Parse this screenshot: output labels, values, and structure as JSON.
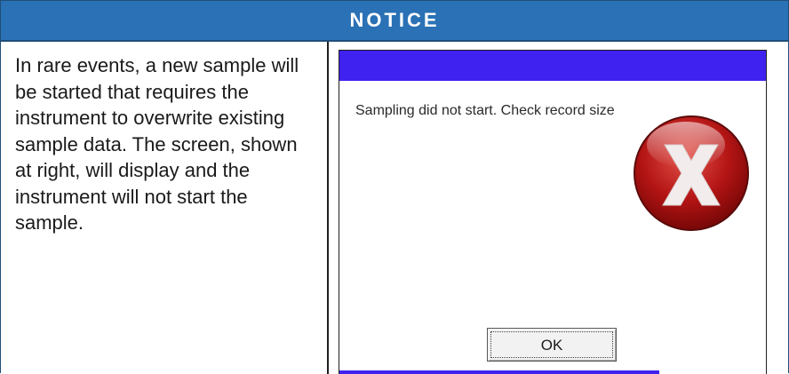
{
  "notice": {
    "title": "NOTICE",
    "body": "In rare events, a new sample will be started that requires the instrument to overwrite existing sample data. The screen, shown at right, will display and the instrument will not start the sample."
  },
  "screen": {
    "message": "Sampling did not start. Check record size",
    "ok_label": "OK",
    "icon": "error-x-icon",
    "titlebar_color": "#3f22f0"
  },
  "colors": {
    "header_bg": "#2a71b5",
    "header_text": "#ffffff",
    "error_red": "#c41e1e"
  }
}
